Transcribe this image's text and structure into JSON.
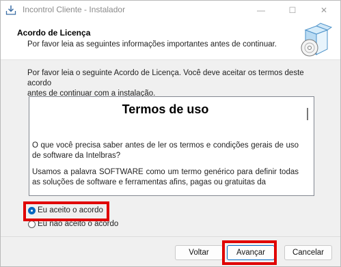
{
  "window": {
    "title": "Incontrol Cliente - Instalador",
    "icon": "installer-icon",
    "controls": {
      "minimize": "—",
      "maximize": "☐",
      "close": "✕"
    }
  },
  "header": {
    "title": "Acordo de Licença",
    "subtitle": "Por favor leia as seguintes informações importantes antes de continuar.",
    "artwork": "software-box-cd-icon"
  },
  "content": {
    "intro_line1": "Por favor leia o seguinte Acordo de Licença. Você deve aceitar os termos deste acordo",
    "intro_line2": "antes de continuar com a instalação.",
    "terms": {
      "heading": "Termos de uso",
      "paragraph1": "O que você precisa saber antes de ler os termos e condições gerais de uso de software da Intelbras?",
      "paragraph2": "Usamos a palavra SOFTWARE como um termo genérico para definir todas as soluções de software e ferramentas afins, pagas ou gratuitas da"
    },
    "radio_accept": {
      "label": "Eu aceito o acordo",
      "checked": true
    },
    "radio_decline": {
      "label": "Eu não aceito o acordo",
      "checked": false
    }
  },
  "buttons": {
    "back": "Voltar",
    "next": "Avançar",
    "cancel": "Cancelar"
  },
  "colors": {
    "highlight": "#e00000",
    "accent": "#0067c0",
    "dialog_bg": "#f0f0f0"
  }
}
